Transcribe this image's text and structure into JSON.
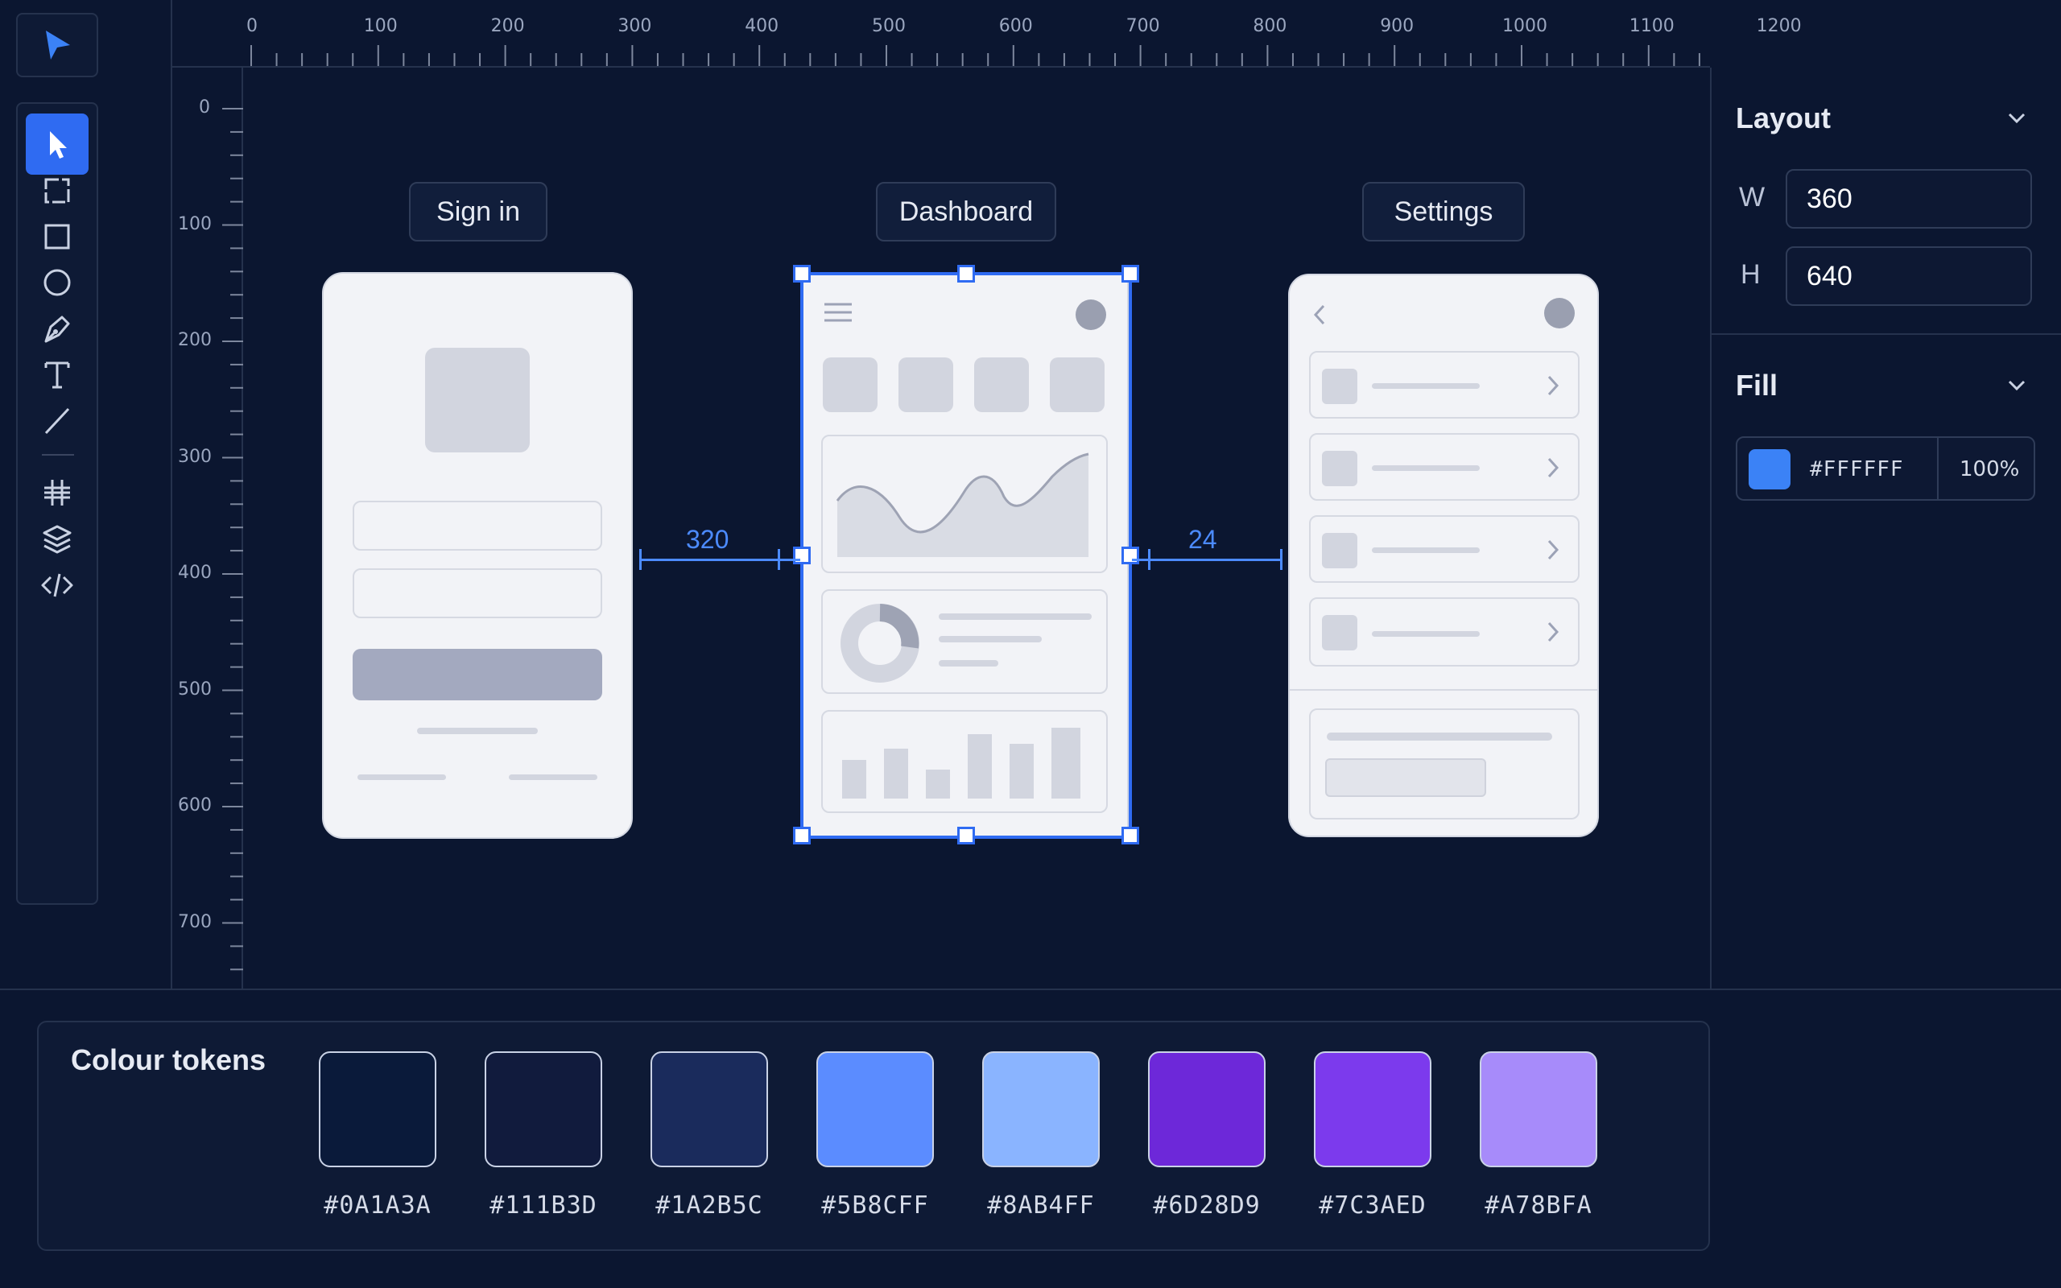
{
  "toolbar": {
    "tools": [
      {
        "icon": "select-arrow-icon",
        "active": true
      },
      {
        "icon": "frame-icon"
      },
      {
        "icon": "rectangle-icon"
      },
      {
        "icon": "ellipse-icon"
      },
      {
        "icon": "pen-icon"
      },
      {
        "icon": "text-icon"
      },
      {
        "icon": "line-icon"
      },
      {
        "icon": "grid-icon"
      },
      {
        "icon": "layers-icon"
      },
      {
        "icon": "code-icon"
      }
    ]
  },
  "ruler": {
    "top_labels": [
      "0",
      "100",
      "200",
      "300",
      "400",
      "500",
      "600",
      "700",
      "800",
      "900",
      "1000",
      "1100",
      "1200"
    ],
    "left_labels": [
      "0",
      "100",
      "200",
      "300",
      "400",
      "500",
      "600",
      "700"
    ]
  },
  "canvas": {
    "frames": [
      {
        "label": "Sign in"
      },
      {
        "label": "Dashboard"
      },
      {
        "label": "Settings"
      }
    ],
    "measure_left": "320",
    "measure_right": "24"
  },
  "panel": {
    "layout_title": "Layout",
    "w_label": "W",
    "w_value": "360",
    "h_label": "H",
    "h_value": "640",
    "fill_title": "Fill",
    "fill_hex": "#FFFFFF",
    "fill_opacity": "100%",
    "fill_swatch_color": "#3B82F6"
  },
  "tokens": {
    "title": "Colour tokens",
    "items": [
      {
        "label": "#0A1A3A",
        "color": "#0A1A3A"
      },
      {
        "label": "#111B3D",
        "color": "#111B3D"
      },
      {
        "label": "#1A2B5C",
        "color": "#1A2B5C"
      },
      {
        "label": "#5B8CFF",
        "color": "#5B8CFF"
      },
      {
        "label": "#8AB4FF",
        "color": "#8AB4FF"
      },
      {
        "label": "#6D28D9",
        "color": "#6D28D9"
      },
      {
        "label": "#7C3AED",
        "color": "#7C3AED"
      },
      {
        "label": "#A78BFA",
        "color": "#A78BFA"
      }
    ]
  }
}
